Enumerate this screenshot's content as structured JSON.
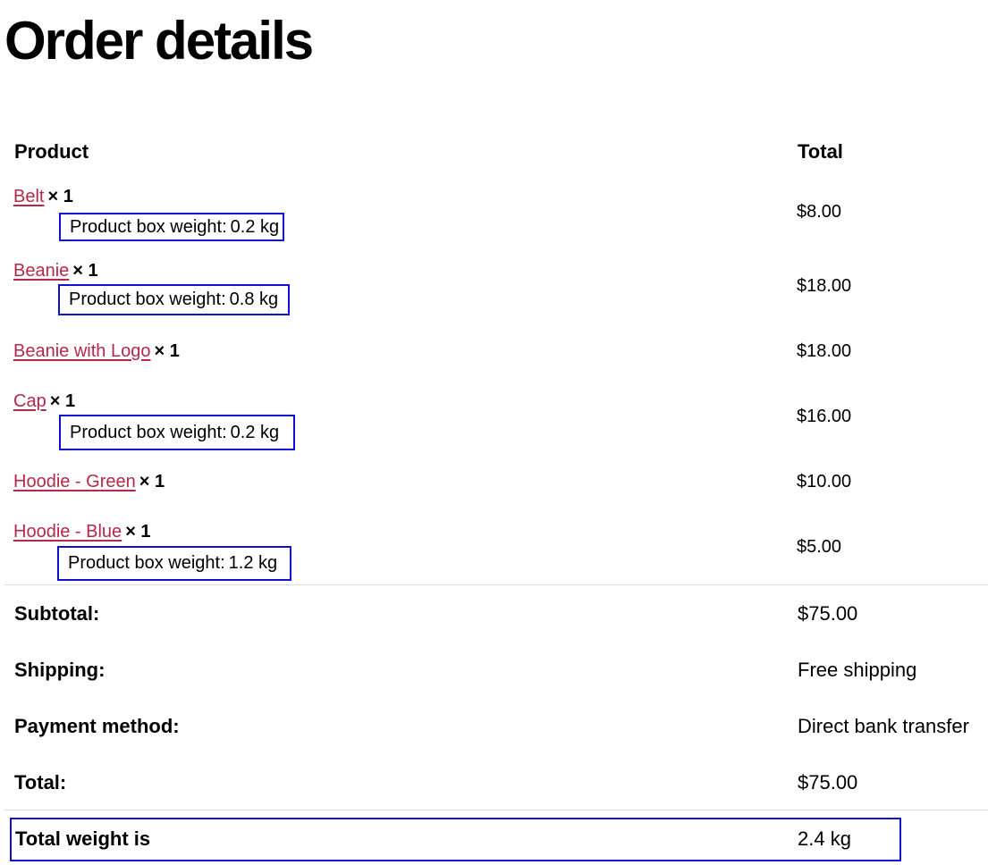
{
  "page": {
    "title": "Order details"
  },
  "table": {
    "headers": {
      "product": "Product",
      "total": "Total"
    },
    "items": [
      {
        "name": "Belt",
        "qty": "× 1",
        "meta_label": "Product box weight:",
        "meta_value": "0.2 kg",
        "price": "$8.00"
      },
      {
        "name": "Beanie",
        "qty": "× 1",
        "meta_label": "Product box weight:",
        "meta_value": "0.8 kg",
        "price": "$18.00"
      },
      {
        "name": "Beanie with Logo",
        "qty": "× 1",
        "price": "$18.00"
      },
      {
        "name": "Cap",
        "qty": "× 1",
        "meta_label": "Product box weight:",
        "meta_value": "0.2 kg",
        "price": "$16.00"
      },
      {
        "name": "Hoodie - Green",
        "qty": "× 1",
        "price": "$10.00"
      },
      {
        "name": "Hoodie - Blue",
        "qty": "× 1",
        "meta_label": "Product box weight:",
        "meta_value": "1.2 kg",
        "price": "$5.00"
      }
    ],
    "summary": {
      "subtotal_label": "Subtotal:",
      "subtotal_value": "$75.00",
      "shipping_label": "Shipping:",
      "shipping_value": "Free shipping",
      "payment_label": "Payment method:",
      "payment_value": "Direct bank transfer",
      "total_label": "Total:",
      "total_value": "$75.00",
      "weight_label": "Total weight is",
      "weight_value": "2.4 kg"
    }
  },
  "colors": {
    "link": "#b5284a",
    "highlight_border": "#1010d0",
    "divider": "#dcdcdc"
  }
}
